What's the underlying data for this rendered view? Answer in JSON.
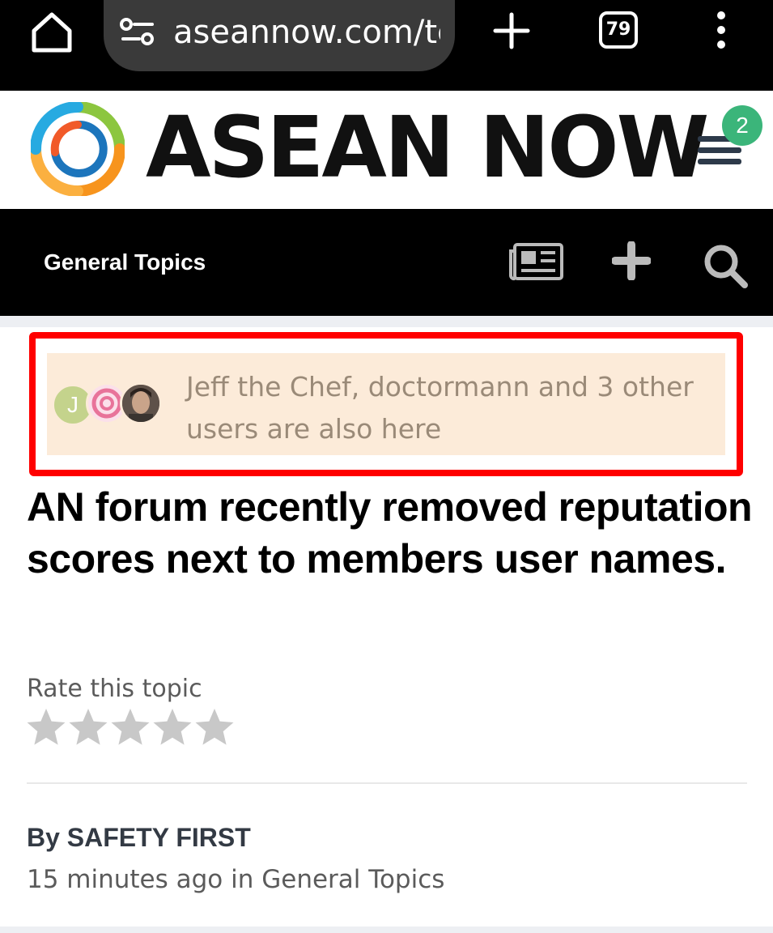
{
  "browser": {
    "url": "aseannow.com/tc",
    "tab_count": "79"
  },
  "site": {
    "logo_text": "ASEAN NOW",
    "notification_count": "2"
  },
  "nav": {
    "section_title": "General Topics"
  },
  "presence": {
    "avatar_initial": "J",
    "text": "Jeff the Chef, doctormann and 3 other users are also here"
  },
  "topic": {
    "title": "AN forum recently removed reputation scores next to members user names.",
    "rate_label": "Rate this topic",
    "rating_stars_filled": 0,
    "rating_stars_total": 5,
    "byline": "By SAFETY FIRST",
    "meta": "15 minutes ago in General Topics"
  },
  "colors": {
    "highlight_border": "#ff0000",
    "presence_bg": "#fcebd9",
    "badge": "#3bb57a",
    "star_empty": "#c8c8c8"
  },
  "icons": [
    "home-icon",
    "site-settings-icon",
    "new-tab-icon",
    "tab-switcher-icon",
    "more-menu-icon",
    "hamburger-menu-icon",
    "news-icon",
    "plus-icon",
    "search-icon",
    "star-icon"
  ]
}
